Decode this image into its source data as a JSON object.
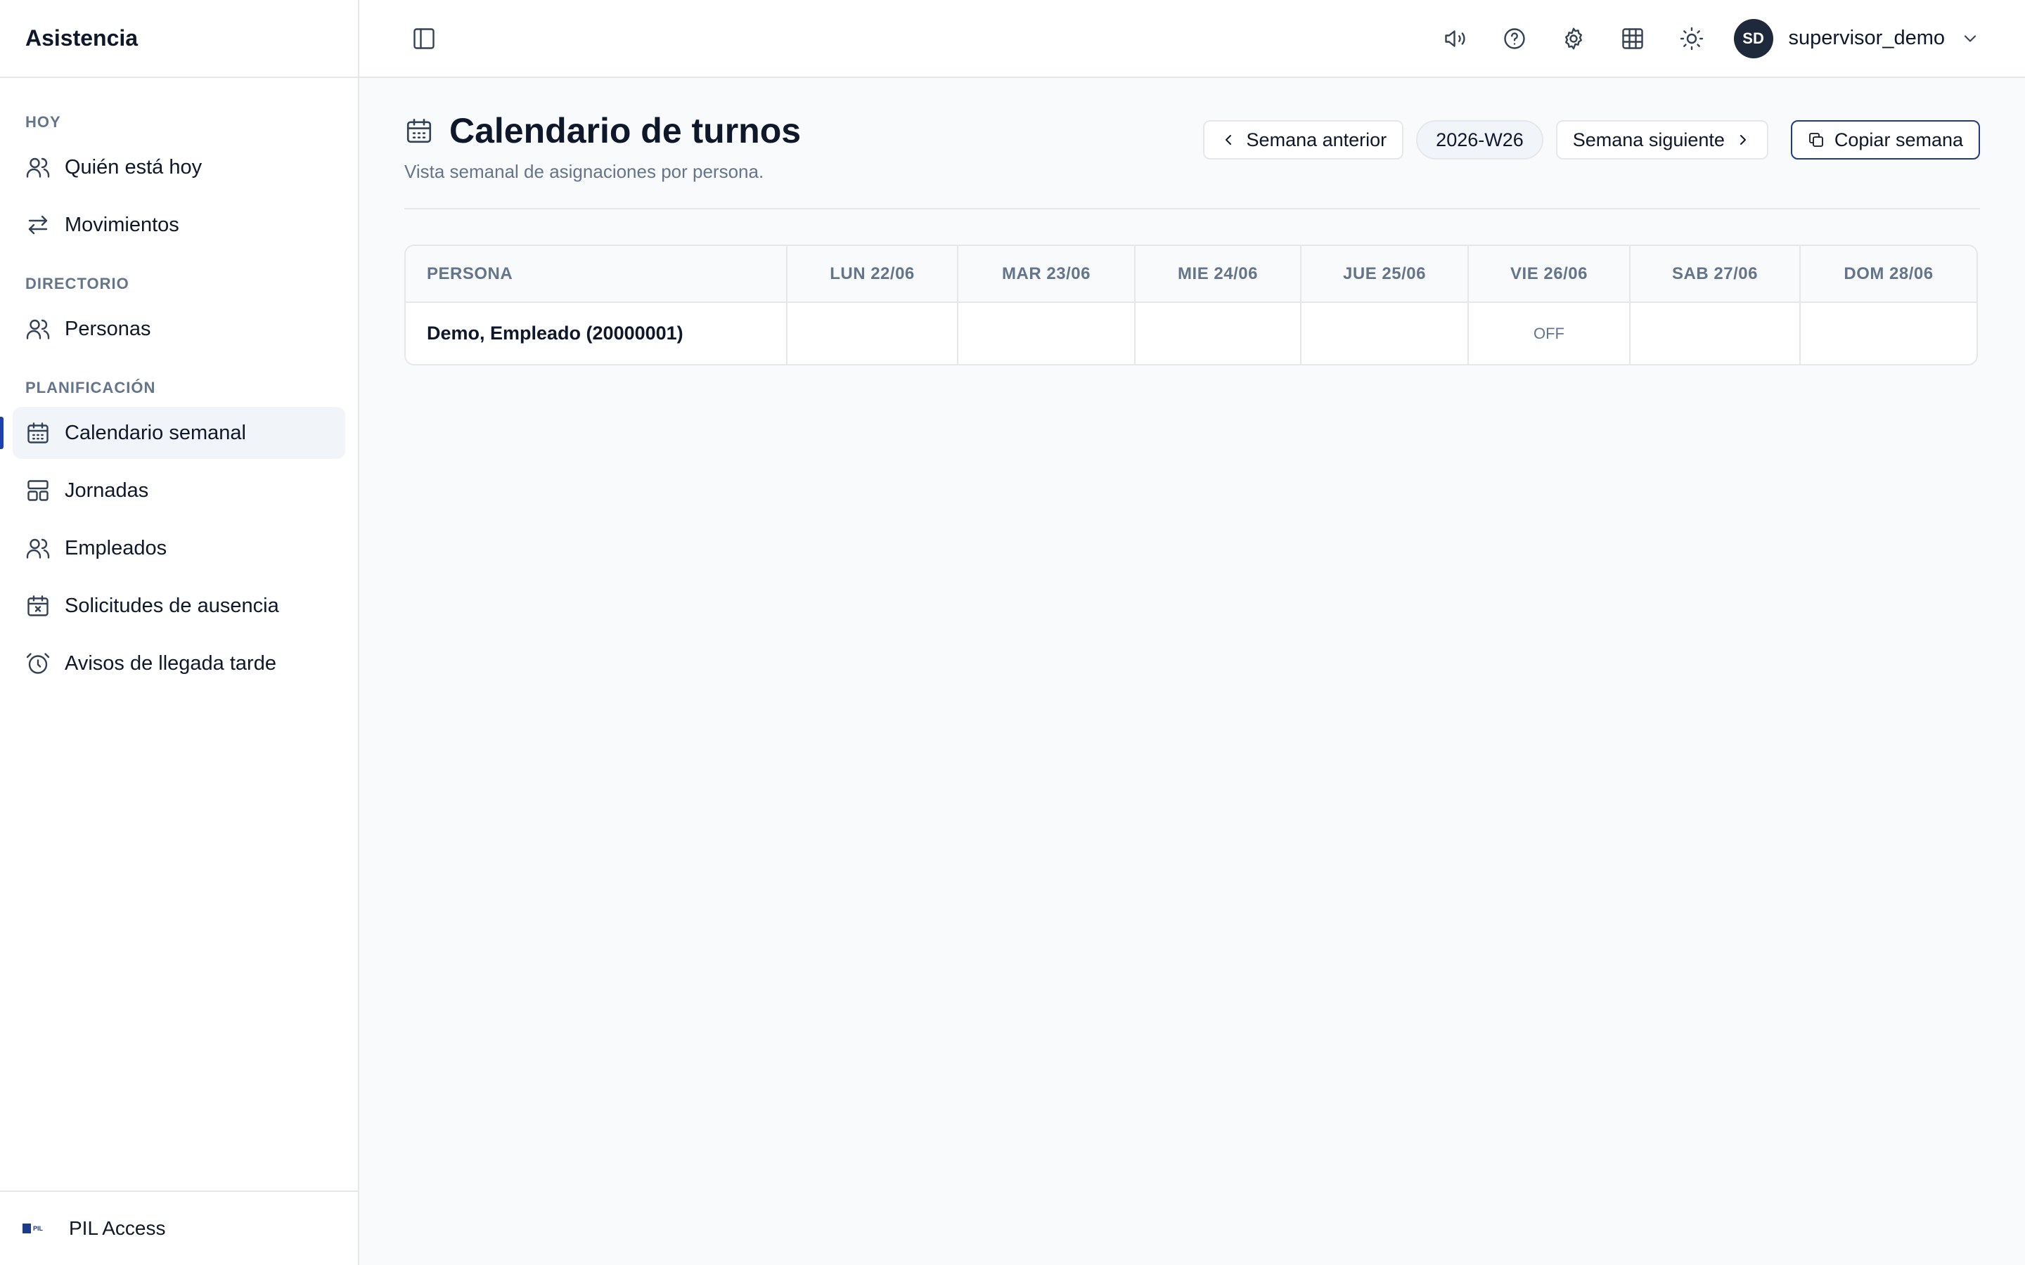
{
  "app": {
    "title": "Asistencia"
  },
  "sidebar": {
    "sections": [
      {
        "label": "HOY",
        "items": [
          {
            "label": "Quién está hoy",
            "icon": "users-icon"
          },
          {
            "label": "Movimientos",
            "icon": "arrows-left-right-icon"
          }
        ]
      },
      {
        "label": "DIRECTORIO",
        "items": [
          {
            "label": "Personas",
            "icon": "users-icon"
          }
        ]
      },
      {
        "label": "PLANIFICACIÓN",
        "items": [
          {
            "label": "Calendario semanal",
            "icon": "calendar-icon",
            "active": true
          },
          {
            "label": "Jornadas",
            "icon": "layout-icon"
          },
          {
            "label": "Empleados",
            "icon": "users-icon"
          },
          {
            "label": "Solicitudes de ausencia",
            "icon": "calendar-x-icon"
          },
          {
            "label": "Avisos de llegada tarde",
            "icon": "alarm-clock-icon"
          }
        ]
      }
    ],
    "footer": {
      "label": "PIL Access",
      "logo_text": "PIL"
    }
  },
  "topbar": {
    "user": {
      "initials": "SD",
      "name": "supervisor_demo"
    }
  },
  "page": {
    "title": "Calendario de turnos",
    "subtitle": "Vista semanal de asignaciones por persona.",
    "prev_week": "Semana anterior",
    "week": "2026-W26",
    "next_week": "Semana siguiente",
    "copy_week": "Copiar semana"
  },
  "table": {
    "headers": [
      "PERSONA",
      "LUN 22/06",
      "MAR 23/06",
      "MIE 24/06",
      "JUE 25/06",
      "VIE 26/06",
      "SAB 27/06",
      "DOM 28/06"
    ],
    "rows": [
      {
        "persona": "Demo, Empleado (20000001)",
        "cells": [
          "",
          "",
          "",
          "",
          "OFF",
          "",
          ""
        ]
      }
    ]
  },
  "colors": {
    "accent": "#1e3a8a",
    "active_indicator": "#1e40af",
    "avatar_bg": "#1e293b"
  }
}
